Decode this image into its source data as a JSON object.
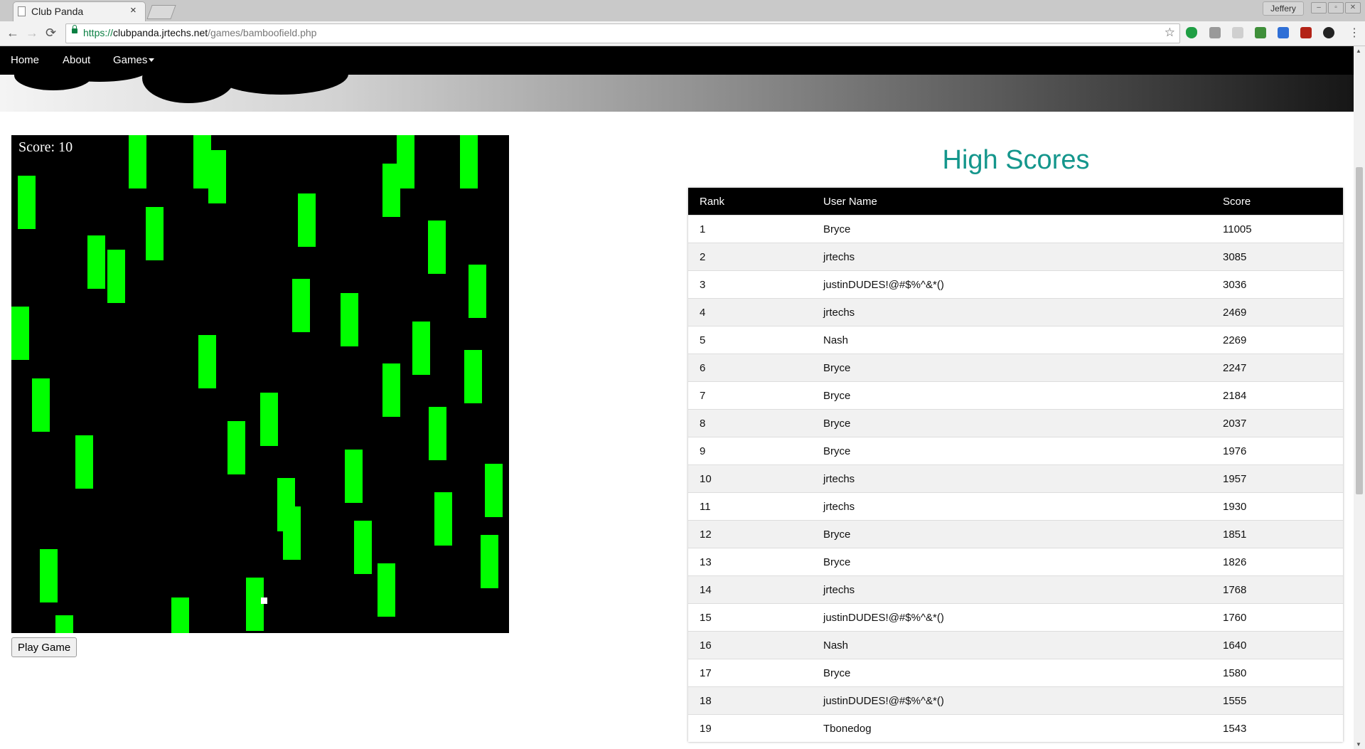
{
  "browser": {
    "tab_title": "Club Panda",
    "tab_close": "×",
    "profile_name": "Jeffery",
    "url_scheme": "https://",
    "url_host": "clubpanda.jrtechs.net",
    "url_path": "/games/bamboofield.php",
    "back": "←",
    "forward": "→",
    "reload": "⟳",
    "bookmark_star": "☆",
    "window_minimize": "–",
    "window_restore": "▫",
    "window_close": "✕"
  },
  "nav": {
    "home": "Home",
    "about": "About",
    "games": "Games"
  },
  "game": {
    "score_text": "Score: 10",
    "play_button": "Play Game",
    "bamboo_color": "#00ff00"
  },
  "high_scores": {
    "title": "High Scores",
    "columns": [
      "Rank",
      "User Name",
      "Score"
    ],
    "rows": [
      [
        "1",
        "Bryce",
        "11005"
      ],
      [
        "2",
        "jrtechs",
        "3085"
      ],
      [
        "3",
        "justinDUDES!@#$%^&*()",
        "3036"
      ],
      [
        "4",
        "jrtechs",
        "2469"
      ],
      [
        "5",
        "Nash",
        "2269"
      ],
      [
        "6",
        "Bryce",
        "2247"
      ],
      [
        "7",
        "Bryce",
        "2184"
      ],
      [
        "8",
        "Bryce",
        "2037"
      ],
      [
        "9",
        "Bryce",
        "1976"
      ],
      [
        "10",
        "jrtechs",
        "1957"
      ],
      [
        "11",
        "jrtechs",
        "1930"
      ],
      [
        "12",
        "Bryce",
        "1851"
      ],
      [
        "13",
        "Bryce",
        "1826"
      ],
      [
        "14",
        "jrtechs",
        "1768"
      ],
      [
        "15",
        "justinDUDES!@#$%^&*()",
        "1760"
      ],
      [
        "16",
        "Nash",
        "1640"
      ],
      [
        "17",
        "Bryce",
        "1580"
      ],
      [
        "18",
        "justinDUDES!@#$%^&*()",
        "1555"
      ],
      [
        "19",
        "Tbonedog",
        "1543"
      ]
    ]
  },
  "colors": {
    "title_accent": "#14968c",
    "nav_background": "#000000"
  }
}
